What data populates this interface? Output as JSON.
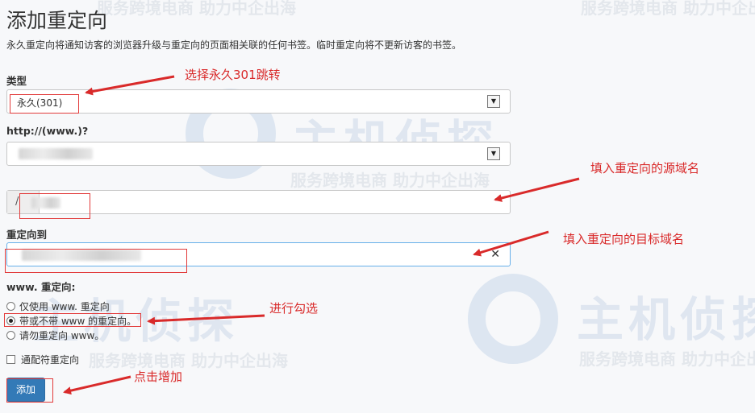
{
  "watermark": {
    "slogan": "服务跨境电商 助力中企出海",
    "brand": "主机侦探"
  },
  "page": {
    "title": "添加重定向",
    "description": "永久重定向将通知访客的浏览器升级与重定向的页面相关联的任何书签。临时重定向将不更新访客的书签。"
  },
  "form": {
    "type_label": "类型",
    "type_value": "永久(301)",
    "domain_label": "http://(www.)?",
    "path_prefix": "/",
    "target_label": "重定向到",
    "clear_glyph": "✕",
    "www_label": "www. 重定向:",
    "www_options": [
      "仅使用 www. 重定向",
      "带或不带 www 的重定向。",
      "请勿重定向 www。"
    ],
    "www_selected_index": 1,
    "wildcard_label": "通配符重定向",
    "submit_label": "添加"
  },
  "annotations": {
    "select_301": "选择永久301跳转",
    "source_domain": "填入重定向的源域名",
    "target_domain": "填入重定向的目标域名",
    "check_option": "进行勾选",
    "click_add": "点击增加"
  },
  "colors": {
    "annotation": "#d92a2a",
    "primary_button": "#337ab7"
  }
}
